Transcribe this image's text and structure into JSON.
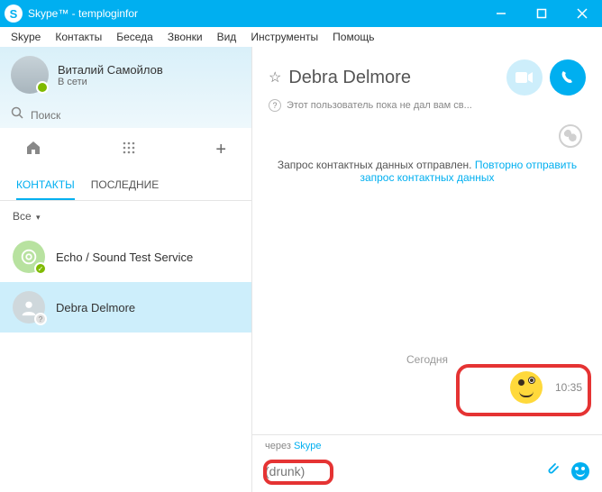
{
  "window": {
    "title": "Skype™ - temploginfor"
  },
  "menu": {
    "items": [
      "Skype",
      "Контакты",
      "Беседа",
      "Звонки",
      "Вид",
      "Инструменты",
      "Помощь"
    ]
  },
  "profile": {
    "name": "Виталий Самойлов",
    "status": "В сети"
  },
  "search": {
    "placeholder": "Поиск"
  },
  "tabs": {
    "contacts": "КОНТАКТЫ",
    "recent": "ПОСЛЕДНИЕ"
  },
  "filter": {
    "label": "Все",
    "arrow": "▾"
  },
  "contacts": [
    {
      "name": "Echo / Sound Test Service"
    },
    {
      "name": "Debra Delmore"
    }
  ],
  "chat": {
    "contact_name": "Debra Delmore",
    "subtitle": "Этот пользователь пока не дал вам св...",
    "notice_text": "Запрос контактных данных отправлен. ",
    "notice_link": "Повторно отправить запрос контактных данных",
    "date_label": "Сегодня",
    "message_time": "10:35",
    "via_label": "через ",
    "via_app": "Skype",
    "compose_value": "(drunk)"
  }
}
